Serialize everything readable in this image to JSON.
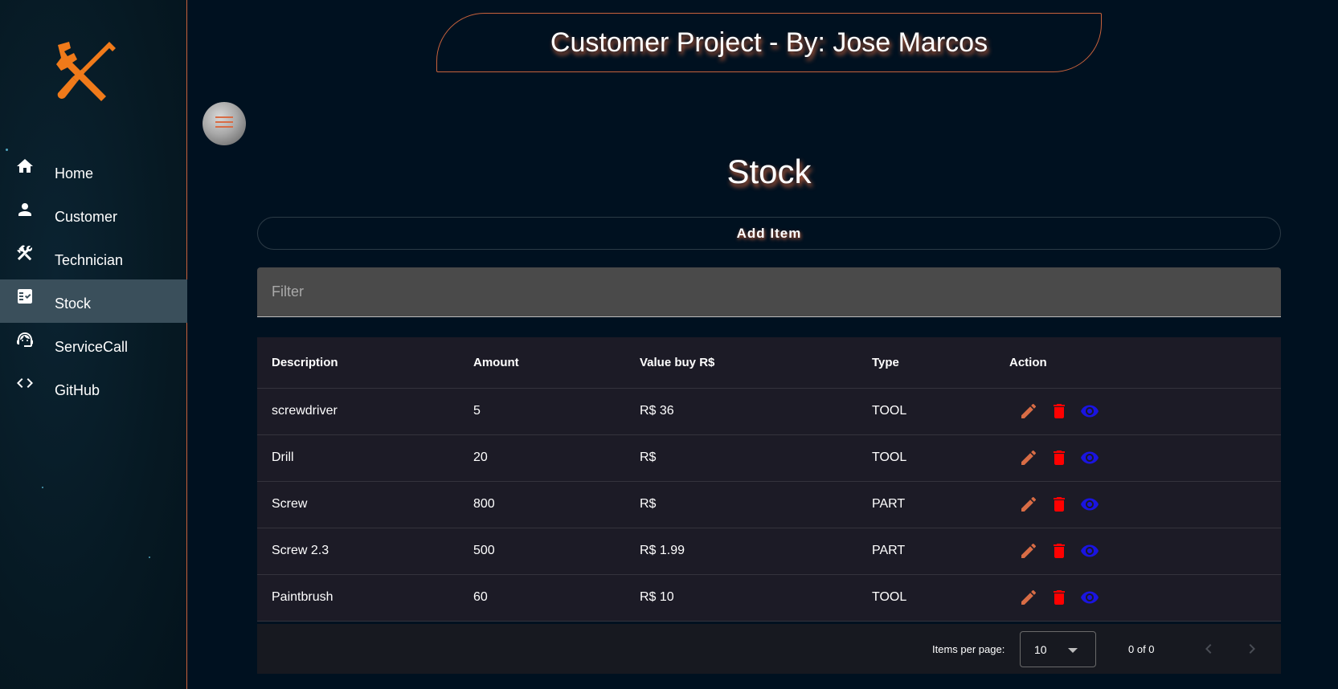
{
  "app": {
    "header_title": "Customer Project - By: Jose Marcos",
    "page_title": "Stock"
  },
  "sidebar": {
    "items": [
      {
        "label": "Home",
        "icon": "home-icon",
        "active": false
      },
      {
        "label": "Customer",
        "icon": "person-icon",
        "active": false
      },
      {
        "label": "Technician",
        "icon": "tools-icon",
        "active": false
      },
      {
        "label": "Stock",
        "icon": "checklist-icon",
        "active": true
      },
      {
        "label": "ServiceCall",
        "icon": "support-agent-icon",
        "active": false
      },
      {
        "label": "GitHub",
        "icon": "code-icon",
        "active": false
      }
    ]
  },
  "toolbar": {
    "add_item_label": "Add Item"
  },
  "filter": {
    "placeholder": "Filter",
    "value": ""
  },
  "table": {
    "columns": [
      "Description",
      "Amount",
      "Value buy R$",
      "Type",
      "Action"
    ],
    "rows": [
      {
        "description": "screwdriver",
        "amount": "5",
        "value": "R$ 36",
        "type": "TOOL"
      },
      {
        "description": "Drill",
        "amount": "20",
        "value": "R$",
        "type": "TOOL"
      },
      {
        "description": "Screw",
        "amount": "800",
        "value": "R$",
        "type": "PART"
      },
      {
        "description": "Screw 2.3",
        "amount": "500",
        "value": "R$ 1.99",
        "type": "PART"
      },
      {
        "description": "Paintbrush",
        "amount": "60",
        "value": "R$ 10",
        "type": "TOOL"
      }
    ]
  },
  "paginator": {
    "items_per_page_label": "Items per page:",
    "items_per_page": "10",
    "range_label": "0 of 0"
  },
  "colors": {
    "accent": "#c8623c",
    "edit": "#d86c45",
    "delete": "#ff0000",
    "view": "#1a14e0",
    "background": "#001120"
  }
}
